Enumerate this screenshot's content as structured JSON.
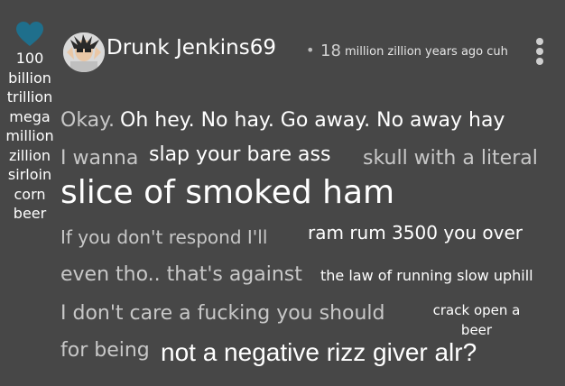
{
  "sidebar": {
    "votes_lines": [
      "100",
      "billion",
      "trillion",
      "mega",
      "million",
      "zillion",
      "sirloin",
      "corn",
      "beer"
    ],
    "colors": {
      "heart": "#1f6f8c"
    }
  },
  "post": {
    "username": "Drunk Jenkins69",
    "separator": "•",
    "time_number": "18",
    "time_text": "million zillion years ago cuh"
  },
  "comment": {
    "line1_a": "Okay.",
    "line1_b": "Oh hey. No hay. Go away. No away hay",
    "line2_a": "I wanna",
    "line2_b": "slap your bare ass",
    "line2_c": "skull with a literal",
    "line3": "slice of smoked ham",
    "line4_a": "If you don't respond I'll",
    "line4_b": "ram rum 3500 you over",
    "line5_a": "even tho.. that's against",
    "line5_b": "the law of running slow uphill",
    "line6_a": "I don't care a fucking you should",
    "line6_b1": "crack open a",
    "line6_b2": "beer",
    "line7_a": "for being",
    "line7_b": "not a negative rizz giver alr?"
  },
  "icons": [
    "heart-icon",
    "avatar",
    "more-options-icon"
  ],
  "colors": {
    "background": "#474747",
    "text_white": "#ffffff",
    "text_grey": "#c8c8c8"
  }
}
